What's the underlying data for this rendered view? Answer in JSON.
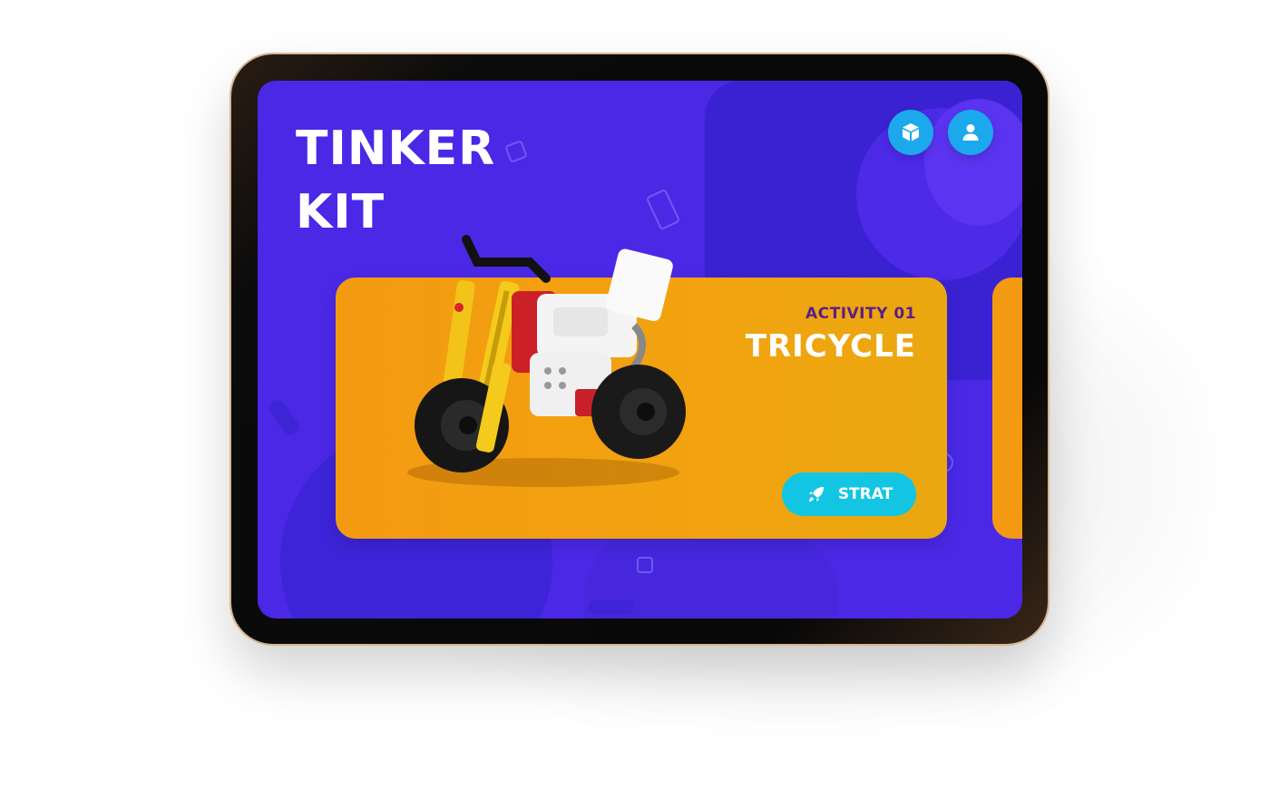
{
  "app": {
    "title_line1": "TINKER",
    "title_line2": "KIT"
  },
  "header": {
    "icons": [
      "box-icon",
      "user-icon"
    ]
  },
  "activity_card": {
    "activity_label": "ACTIVITY 01",
    "title": "TRICYCLE",
    "start_label": "STRAT",
    "start_icon": "rocket-icon"
  },
  "colors": {
    "background": "#4a28e6",
    "card": "#f49a12",
    "accent_button": "#12c6e3",
    "icon_button": "#1ba8ec",
    "activity_label": "#5a1f8a"
  }
}
